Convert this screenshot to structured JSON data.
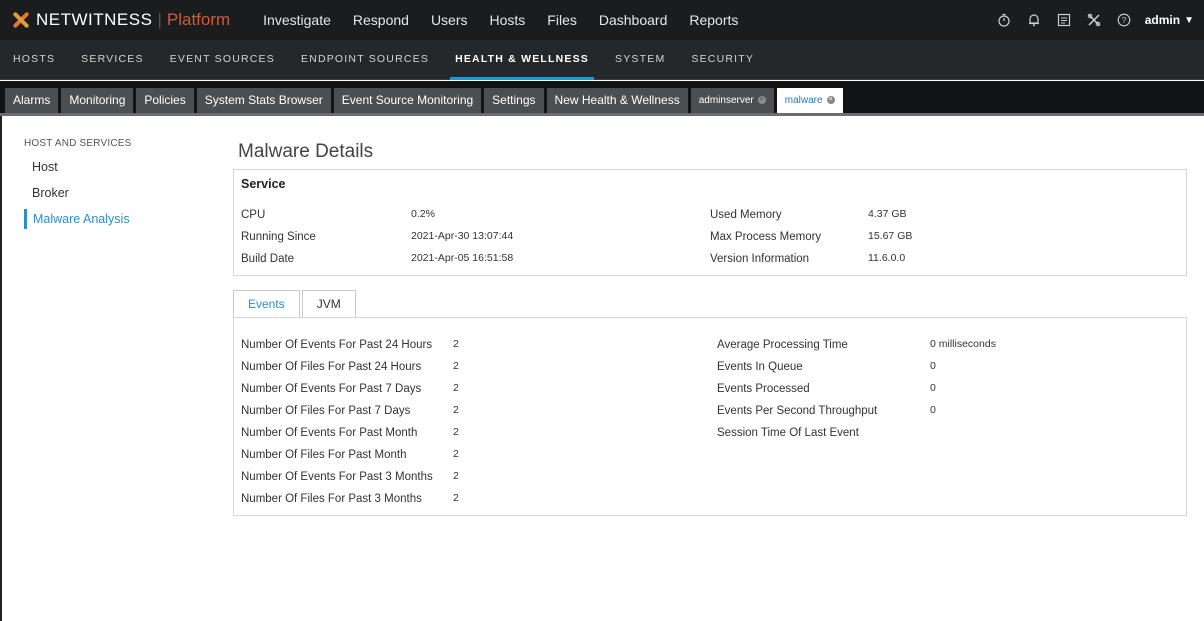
{
  "brand": {
    "name": "NETWITNESS",
    "product": "Platform"
  },
  "top_nav": [
    "Investigate",
    "Respond",
    "Users",
    "Hosts",
    "Files",
    "Dashboard",
    "Reports"
  ],
  "top_icons": [
    "stopwatch-icon",
    "bell-icon",
    "notes-icon",
    "tools-icon",
    "help-icon"
  ],
  "user": {
    "name": "admin"
  },
  "sub_nav": [
    {
      "label": "HOSTS"
    },
    {
      "label": "SERVICES"
    },
    {
      "label": "EVENT SOURCES"
    },
    {
      "label": "ENDPOINT SOURCES"
    },
    {
      "label": "HEALTH & WELLNESS",
      "active": true
    },
    {
      "label": "SYSTEM"
    },
    {
      "label": "SECURITY"
    }
  ],
  "tabs": [
    {
      "label": "Alarms"
    },
    {
      "label": "Monitoring"
    },
    {
      "label": "Policies"
    },
    {
      "label": "System Stats Browser"
    },
    {
      "label": "Event Source Monitoring"
    },
    {
      "label": "Settings"
    },
    {
      "label": "New Health & Wellness"
    },
    {
      "label": "adminserver",
      "closable": true
    },
    {
      "label": "malware",
      "closable": true,
      "active": true
    }
  ],
  "sidebar": {
    "heading": "HOST AND SERVICES",
    "items": [
      "Host",
      "Broker",
      "Malware Analysis"
    ],
    "active_index": 2
  },
  "page_title": "Malware Details",
  "service": {
    "title": "Service",
    "left": [
      {
        "label": "CPU",
        "value": "0.2%"
      },
      {
        "label": "Running Since",
        "value": "2021-Apr-30 13:07:44"
      },
      {
        "label": "Build Date",
        "value": "2021-Apr-05 16:51:58"
      }
    ],
    "right": [
      {
        "label": "Used Memory",
        "value": "4.37 GB"
      },
      {
        "label": "Max Process Memory",
        "value": "15.67 GB"
      },
      {
        "label": "Version Information",
        "value": "11.6.0.0"
      }
    ]
  },
  "detail_tabs": [
    {
      "label": "Events",
      "active": true
    },
    {
      "label": "JVM"
    }
  ],
  "events": {
    "left": [
      {
        "label": "Number Of Events For Past 24 Hours",
        "value": "2"
      },
      {
        "label": "Number Of Files For Past 24 Hours",
        "value": "2"
      },
      {
        "label": "Number Of Events For Past 7 Days",
        "value": "2"
      },
      {
        "label": "Number Of Files For Past 7 Days",
        "value": "2"
      },
      {
        "label": "Number Of Events For Past Month",
        "value": "2"
      },
      {
        "label": "Number Of Files For Past Month",
        "value": "2"
      },
      {
        "label": "Number Of Events For Past 3 Months",
        "value": "2"
      },
      {
        "label": "Number Of Files For Past 3 Months",
        "value": "2"
      }
    ],
    "right": [
      {
        "label": "Average Processing Time",
        "value": "0 milliseconds"
      },
      {
        "label": "Events In Queue",
        "value": "0"
      },
      {
        "label": "Events Processed",
        "value": "0"
      },
      {
        "label": "Events Per Second Throughput",
        "value": "0"
      },
      {
        "label": "Session Time Of Last Event",
        "value": ""
      }
    ]
  },
  "colors": {
    "accent": "#2a8fcc",
    "brand_orange": "#e57432",
    "platform_red": "#d05a3a",
    "topbar": "#1a1c1e"
  }
}
